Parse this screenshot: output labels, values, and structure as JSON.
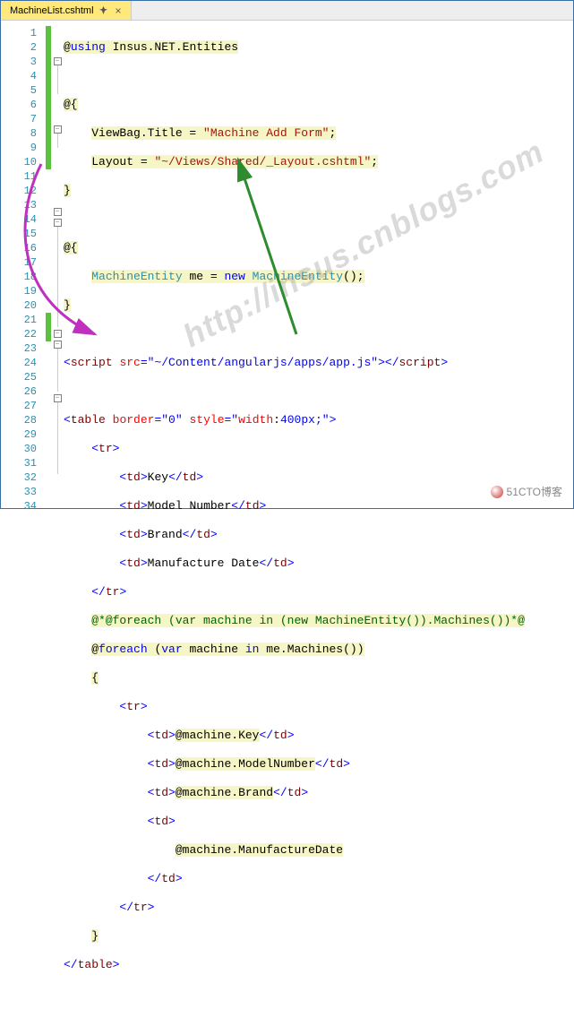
{
  "tab": {
    "filename": "MachineList.cshtml"
  },
  "watermark": "http://insus.cnblogs.com",
  "credit": "51CTO博客",
  "lines": {
    "l1": {
      "at": "@",
      "kw": "using",
      "rest": " Insus.NET.Entities"
    },
    "l3": {
      "at": "@{"
    },
    "l4a": "ViewBag.Title = ",
    "l4b": "\"Machine Add Form\"",
    "l4c": ";",
    "l5a": "Layout = ",
    "l5b": "\"~/Views/Shared/_Layout.cshtml\"",
    "l5c": ";",
    "l6": "}",
    "l8": {
      "at": "@{"
    },
    "l9a": "MachineEntity",
    "l9b": " me = ",
    "l9c": "new",
    "l9d": " ",
    "l9e": "MachineEntity",
    "l9f": "();",
    "l10": "}",
    "l12a": "<",
    "l12b": "script",
    "l12c": " ",
    "l12d": "src",
    "l12e": "=\"~/Content/angularjs/apps/app.js\"",
    "l12f": "></",
    "l12g": "script",
    "l12h": ">",
    "l14a": "<",
    "l14b": "table",
    "l14c": " ",
    "l14d": "border",
    "l14e": "=\"0\"",
    "l14f": " ",
    "l14g": "style",
    "l14h": "=\"",
    "l14i": "width",
    "l14j": ":",
    "l14k": "400px",
    "l14l": ";\"",
    "l14m": ">",
    "l15a": "<",
    "l15b": "tr",
    "l15c": ">",
    "l16a": "<",
    "l16b": "td",
    "l16c": ">",
    "l16d": "Key",
    "l16e": "</",
    "l16f": "td",
    "l16g": ">",
    "l17a": "<",
    "l17b": "td",
    "l17c": ">",
    "l17d": "Model Number",
    "l17e": "</",
    "l17f": "td",
    "l17g": ">",
    "l18a": "<",
    "l18b": "td",
    "l18c": ">",
    "l18d": "Brand",
    "l18e": "</",
    "l18f": "td",
    "l18g": ">",
    "l19a": "<",
    "l19b": "td",
    "l19c": ">",
    "l19d": "Manufacture Date",
    "l19e": "</",
    "l19f": "td",
    "l19g": ">",
    "l20a": "</",
    "l20b": "tr",
    "l20c": ">",
    "l21": "@*@foreach (var machine in (new MachineEntity()).Machines())*@",
    "l22at": "@",
    "l22kw": "foreach",
    "l22a": " (",
    "l22var": "var",
    "l22b": " machine ",
    "l22in": "in",
    "l22c": " me.Machines())",
    "l23": "{",
    "l24a": "<",
    "l24b": "tr",
    "l24c": ">",
    "l25a": "<",
    "l25b": "td",
    "l25c": ">",
    "l25at": "@",
    "l25d": "machine.Key",
    "l25e": "</",
    "l25f": "td",
    "l25g": ">",
    "l26a": "<",
    "l26b": "td",
    "l26c": ">",
    "l26at": "@",
    "l26d": "machine.ModelNumber",
    "l26e": "</",
    "l26f": "td",
    "l26g": ">",
    "l27a": "<",
    "l27b": "td",
    "l27c": ">",
    "l27at": "@",
    "l27d": "machine.Brand",
    "l27e": "</",
    "l27f": "td",
    "l27g": ">",
    "l28a": "<",
    "l28b": "td",
    "l28c": ">",
    "l29at": "@",
    "l29d": "machine.ManufactureDate",
    "l30a": "</",
    "l30b": "td",
    "l30c": ">",
    "l31a": "</",
    "l31b": "tr",
    "l31c": ">",
    "l32": "}",
    "l33a": "</",
    "l33b": "table",
    "l33c": ">"
  }
}
